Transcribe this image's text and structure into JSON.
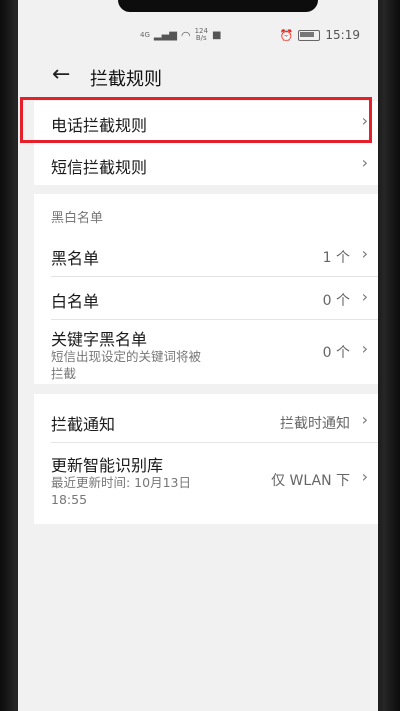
{
  "status": {
    "signal": "4G",
    "speed_value": "124",
    "speed_unit": "B/s",
    "time": "15:19"
  },
  "header": {
    "title": "拦截规则"
  },
  "rules": [
    {
      "label": "电话拦截规则"
    },
    {
      "label": "短信拦截规则"
    }
  ],
  "list_section": {
    "header": "黑白名单",
    "items": [
      {
        "label": "黑名单",
        "value": "1 个"
      },
      {
        "label": "白名单",
        "value": "0 个"
      },
      {
        "label": "关键字黑名单",
        "subtitle_line1": "短信出现设定的关键词将被",
        "subtitle_line2": "拦截",
        "value": "0 个"
      }
    ]
  },
  "notify_section": {
    "items": [
      {
        "label": "拦截通知",
        "value": "拦截时通知"
      },
      {
        "label": "更新智能识别库",
        "subtitle_line1": "最近更新时间: 10月13日",
        "subtitle_line2": "18:55",
        "value": "仅 WLAN 下"
      }
    ]
  },
  "colors": {
    "highlight": "#e6202a",
    "background": "#f1f1f1",
    "card": "#ffffff"
  }
}
